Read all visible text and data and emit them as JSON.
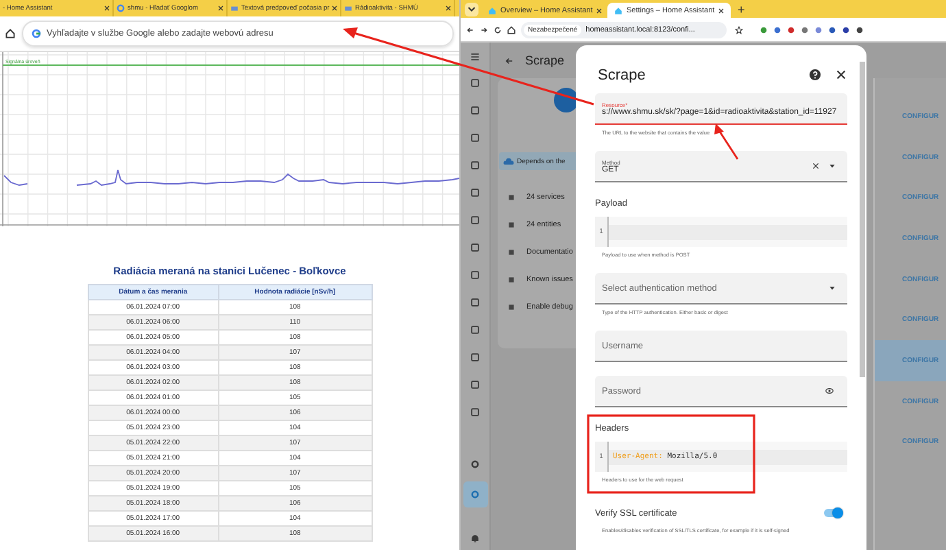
{
  "left_browser": {
    "tabs": [
      {
        "title": "- Home Assistant"
      },
      {
        "title": "shmu - Hľadať Googlom"
      },
      {
        "title": "Textová predpoveď počasia pr"
      },
      {
        "title": "Rádioaktivita - SHMÚ"
      }
    ],
    "address_placeholder": "Vyhľadajte v službe Google alebo zadajte webovú adresu"
  },
  "chart": {
    "line_label": "Signálna úroveň"
  },
  "table": {
    "title": "Radiácia meraná na stanici Lučenec - Boľkovce",
    "columns": [
      "Dátum a čas merania",
      "Hodnota radiácie [nSv/h]"
    ],
    "rows": [
      [
        "06.01.2024 07:00",
        "108"
      ],
      [
        "06.01.2024 06:00",
        "110"
      ],
      [
        "06.01.2024 05:00",
        "108"
      ],
      [
        "06.01.2024 04:00",
        "107"
      ],
      [
        "06.01.2024 03:00",
        "108"
      ],
      [
        "06.01.2024 02:00",
        "108"
      ],
      [
        "06.01.2024 01:00",
        "105"
      ],
      [
        "06.01.2024 00:00",
        "106"
      ],
      [
        "05.01.2024 23:00",
        "104"
      ],
      [
        "05.01.2024 22:00",
        "107"
      ],
      [
        "05.01.2024 21:00",
        "104"
      ],
      [
        "05.01.2024 20:00",
        "107"
      ],
      [
        "05.01.2024 19:00",
        "105"
      ],
      [
        "05.01.2024 18:00",
        "106"
      ],
      [
        "05.01.2024 17:00",
        "104"
      ],
      [
        "05.01.2024 16:00",
        "108"
      ]
    ]
  },
  "right_browser": {
    "tabs": [
      {
        "title": "Overview – Home Assistant",
        "selected": false
      },
      {
        "title": "Settings – Home Assistant",
        "selected": true
      }
    ],
    "new_tab": "+",
    "security": "Nezabezpečené",
    "url": "homeassistant.local:8123/confi..."
  },
  "sidebar": {
    "items": [
      {
        "selected": false
      },
      {
        "selected": false
      },
      {
        "selected": false
      },
      {
        "selected": false
      },
      {
        "selected": false
      },
      {
        "selected": false
      },
      {
        "selected": false
      },
      {
        "selected": false
      },
      {
        "selected": false
      },
      {
        "selected": false
      },
      {
        "selected": false
      },
      {
        "selected": false
      },
      {
        "selected": false
      }
    ],
    "footer_items": [
      {
        "selected": false
      },
      {
        "selected": true
      }
    ]
  },
  "page": {
    "title": "Scrape"
  },
  "card": {
    "banner": "Depends on the",
    "links": [
      "24 services",
      "24 entities",
      "Documentatio",
      "Known issues",
      "Enable debug"
    ]
  },
  "configure_rows": [
    {
      "label": "CONFIGUR",
      "selected": false
    },
    {
      "label": "CONFIGUR",
      "selected": false
    },
    {
      "label": "CONFIGUR",
      "selected": false
    },
    {
      "label": "CONFIGUR",
      "selected": false
    },
    {
      "label": "CONFIGUR",
      "selected": false
    },
    {
      "label": "CONFIGUR",
      "selected": false
    },
    {
      "label": "CONFIGUR",
      "selected": true
    },
    {
      "label": "CONFIGUR",
      "selected": false
    },
    {
      "label": "CONFIGUR",
      "selected": false
    }
  ],
  "dialog": {
    "title": "Scrape",
    "fields": [
      {
        "kind": "text",
        "label": "Resource*",
        "value": "s://www.shmu.sk/sk/?page=1&id=radioaktivita&station_id=11927",
        "invalid": true,
        "helper": "The URL to the website that contains the value"
      },
      {
        "kind": "select",
        "label": "Method",
        "value": "GET",
        "clearable": true
      },
      {
        "kind": "code",
        "heading": "Payload",
        "lines": [
          {
            "number": "1"
          }
        ],
        "helper": "Payload to use when method is POST"
      },
      {
        "kind": "select",
        "placeholder": "Select authentication method",
        "clearable": false,
        "helper": "Type of the HTTP authentication. Either basic or digest"
      },
      {
        "kind": "text",
        "placeholder": "Username",
        "invalid": false
      },
      {
        "kind": "password",
        "placeholder": "Password"
      },
      {
        "kind": "code",
        "heading": "Headers",
        "lines": [
          {
            "number": "1",
            "key": "User-Agent:",
            "value": " Mozilla/5.0"
          }
        ],
        "helper": "Headers to use for the web request"
      },
      {
        "kind": "toggle",
        "label": "Verify SSL certificate",
        "on": true,
        "helper": "Enables/disables verification of SSL/TLS certificate, for example if it is self-signed"
      }
    ]
  }
}
